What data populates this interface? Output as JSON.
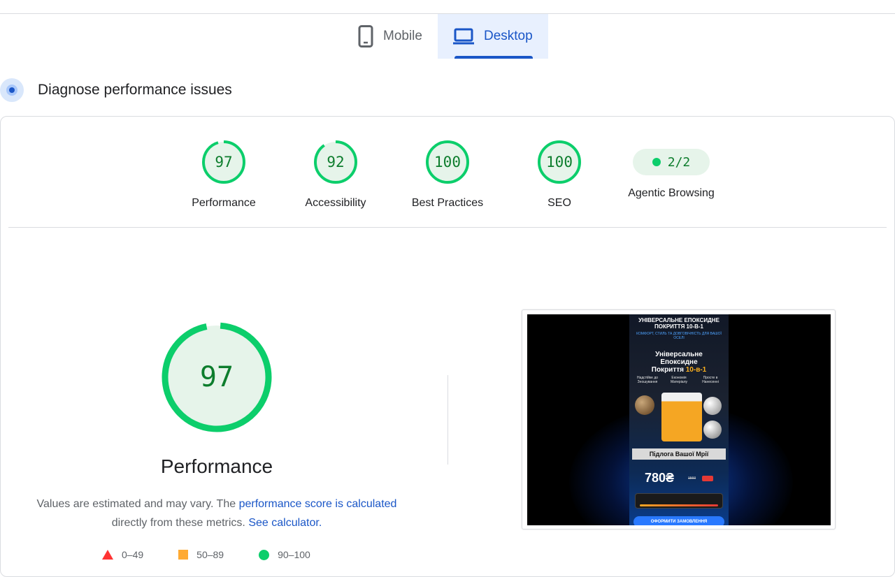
{
  "device_tabs": [
    {
      "label": "Mobile",
      "icon": "smartphone-icon",
      "selected": false
    },
    {
      "label": "Desktop",
      "icon": "laptop-icon",
      "selected": true
    }
  ],
  "diagnose": {
    "title": "Diagnose performance issues",
    "icon": "target-icon"
  },
  "categories": [
    {
      "label": "Performance",
      "score": "97",
      "color": "#0cce6b"
    },
    {
      "label": "Accessibility",
      "score": "92",
      "color": "#0cce6b"
    },
    {
      "label": "Best Practices",
      "score": "100",
      "color": "#0cce6b"
    },
    {
      "label": "SEO",
      "score": "100",
      "color": "#0cce6b"
    }
  ],
  "agentic": {
    "label": "Agentic Browsing",
    "value": "2/2"
  },
  "performance": {
    "score": "97",
    "score_fraction": 0.97,
    "title": "Performance",
    "note_pre": "Values are estimated and may vary. The ",
    "note_link1": "performance score is calculated",
    "note_mid": "directly from these metrics. ",
    "note_link2": "See calculator."
  },
  "legend": [
    {
      "label": "0–49",
      "color": "#ff3333"
    },
    {
      "label": "50–89",
      "color": "#ffaa33"
    },
    {
      "label": "90–100",
      "color": "#0cce6b"
    }
  ],
  "screenshot": {
    "header": "УНІВЕРСАЛЬНЕ ЕПОКСИДНЕ ПОКРИТТЯ 10-В-1",
    "subheader": "КОМФОРТ, СТИЛЬ ТА ДОВГОВІЧНІСТЬ ДЛЯ ВАШОЇ ОСЕЛІ",
    "title_line1": "Універсальне",
    "title_line2": "Епоксидне",
    "title_line3": "Покриття ",
    "title_accent": "10-в-1",
    "features": [
      "Надстійке до Зношування",
      "Економія Матеріалу",
      "Просте в Нанесенні"
    ],
    "banner": "Підлога Вашої Мрії",
    "price": "780₴",
    "old_price": "1560",
    "cta": "ОФОРМИТИ ЗАМОВЛЕННЯ"
  },
  "colors": {
    "accent": "#1a56c7",
    "pass": "#0cce6b",
    "pass_text": "#0d7d2d"
  }
}
